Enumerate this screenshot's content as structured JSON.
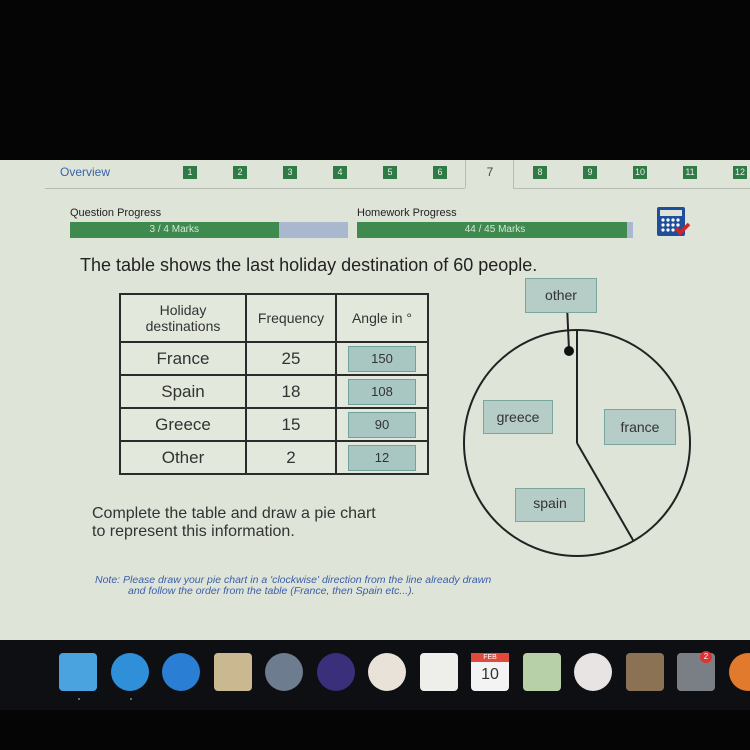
{
  "tabs": {
    "overview": "Overview",
    "items": [
      "1",
      "2",
      "3",
      "4",
      "5",
      "6",
      "7",
      "8",
      "9",
      "10",
      "11",
      "12"
    ],
    "active": "7"
  },
  "progress": {
    "question_label": "Question Progress",
    "question_text": "3 / 4 Marks",
    "question_fraction": 0.75,
    "homework_label": "Homework Progress",
    "homework_text": "44 / 45 Marks",
    "homework_fraction": 0.978
  },
  "icons": {
    "calculator": "calculator-icon"
  },
  "question": {
    "text": "The table shows the last holiday destination of 60 people.",
    "instruction_line1": "Complete the table and draw a pie chart",
    "instruction_line2": "to represent this information.",
    "note_line1": "Note: Please draw your pie chart in a 'clockwise' direction from the line already drawn",
    "note_line2": "and follow the order from the table (France, then Spain etc...)."
  },
  "table": {
    "headers": [
      "Holiday destinations",
      "Frequency",
      "Angle in °"
    ],
    "header_line1": "Holiday",
    "header_line2": "destinations",
    "rows": [
      {
        "destination": "France",
        "frequency": "25",
        "angle": "150"
      },
      {
        "destination": "Spain",
        "frequency": "18",
        "angle": "108"
      },
      {
        "destination": "Greece",
        "frequency": "15",
        "angle": "90"
      },
      {
        "destination": "Other",
        "frequency": "2",
        "angle": "12"
      }
    ]
  },
  "chart_data": {
    "type": "pie",
    "title": "",
    "categories": [
      "france",
      "spain",
      "greece",
      "other"
    ],
    "values": [
      150,
      108,
      90,
      12
    ],
    "drawn_lines_deg": [
      0,
      150
    ],
    "labels": {
      "other": "other",
      "greece": "greece",
      "france": "france",
      "spain": "spain"
    }
  },
  "dock": {
    "items": [
      "Finder",
      "Safari",
      "App Store",
      "Mail",
      "Launchpad",
      "Siri",
      "Photos",
      "Reminders",
      "Calendar",
      "Maps",
      "News",
      "Notes",
      "System Preferences",
      "Books"
    ],
    "calendar_month": "FEB",
    "calendar_day": "10",
    "badge_count": "2"
  }
}
